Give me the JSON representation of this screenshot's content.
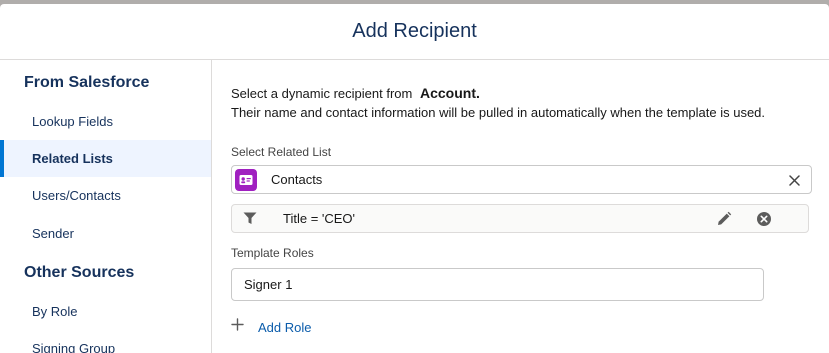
{
  "modal": {
    "title": "Add Recipient"
  },
  "sidebar": {
    "section1_heading": "From Salesforce",
    "section1_items": [
      {
        "label": "Lookup Fields"
      },
      {
        "label": "Related Lists"
      },
      {
        "label": "Users/Contacts"
      },
      {
        "label": "Sender"
      }
    ],
    "section2_heading": "Other Sources",
    "section2_items": [
      {
        "label": "By Role"
      },
      {
        "label": "Signing Group"
      }
    ]
  },
  "content": {
    "intro_prefix": "Select a dynamic recipient from",
    "intro_object": "Account.",
    "intro_line2": "Their name and contact information will be pulled in automatically when the template is used.",
    "related_list_label": "Select Related List",
    "related_list_value": "Contacts",
    "filter_text": "Title = 'CEO'",
    "template_roles_label": "Template Roles",
    "role_value": "Signer 1",
    "add_role_label": "Add Role"
  },
  "colors": {
    "accent": "#0176d3",
    "heading": "#16325c",
    "object_icon": "#a020c0",
    "link": "#0b5cab",
    "active_bg": "#eef4ff"
  },
  "icons": [
    "contact-card-icon",
    "clear-icon",
    "filter-icon",
    "edit-pencil-icon",
    "remove-circle-icon",
    "plus-icon"
  ]
}
